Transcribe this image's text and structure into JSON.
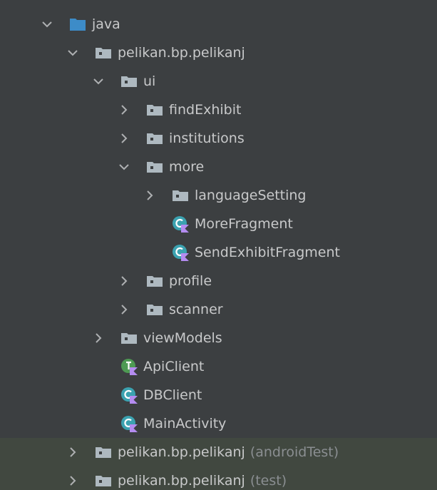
{
  "colors": {
    "background": "#3c3f41",
    "highlight_row": "#414840",
    "text": "#c8c9ca",
    "suffix_text": "#8a8e91",
    "arrow": "#aeb0b2",
    "folder_gray": "#aeb9c0",
    "folder_blue": "#3d8cc8",
    "class_teal": "#3ba2b0",
    "class_green": "#4e9a53",
    "kotlin_purple": "#b48cf0"
  },
  "tree": {
    "items": [
      {
        "label": "java",
        "level": 0,
        "arrow": "expanded",
        "icon": "folder-blue-icon",
        "highlight": false
      },
      {
        "label": "pelikan.bp.pelikanj",
        "level": 1,
        "arrow": "expanded",
        "icon": "package-folder-icon",
        "highlight": false
      },
      {
        "label": "ui",
        "level": 2,
        "arrow": "expanded",
        "icon": "package-folder-icon",
        "highlight": false
      },
      {
        "label": "findExhibit",
        "level": 3,
        "arrow": "collapsed",
        "icon": "package-folder-icon",
        "highlight": false
      },
      {
        "label": "institutions",
        "level": 3,
        "arrow": "collapsed",
        "icon": "package-folder-icon",
        "highlight": false
      },
      {
        "label": "more",
        "level": 3,
        "arrow": "expanded",
        "icon": "package-folder-icon",
        "highlight": false
      },
      {
        "label": "languageSetting",
        "level": 4,
        "arrow": "collapsed",
        "icon": "package-folder-icon",
        "highlight": false
      },
      {
        "label": "MoreFragment",
        "level": 4,
        "arrow": "none",
        "icon": "kotlin-class-icon",
        "highlight": false
      },
      {
        "label": "SendExhibitFragment",
        "level": 4,
        "arrow": "none",
        "icon": "kotlin-class-icon",
        "highlight": false
      },
      {
        "label": "profile",
        "level": 3,
        "arrow": "collapsed",
        "icon": "package-folder-icon",
        "highlight": false
      },
      {
        "label": "scanner",
        "level": 3,
        "arrow": "collapsed",
        "icon": "package-folder-icon",
        "highlight": false
      },
      {
        "label": "viewModels",
        "level": 2,
        "arrow": "collapsed",
        "icon": "package-folder-icon",
        "highlight": false
      },
      {
        "label": "ApiClient",
        "level": 2,
        "arrow": "none",
        "icon": "kotlin-interface-icon",
        "highlight": false
      },
      {
        "label": "DBClient",
        "level": 2,
        "arrow": "none",
        "icon": "kotlin-class-icon",
        "highlight": false
      },
      {
        "label": "MainActivity",
        "level": 2,
        "arrow": "none",
        "icon": "kotlin-class-icon",
        "highlight": false
      },
      {
        "label": "pelikan.bp.pelikanj",
        "suffix": "(androidTest)",
        "level": 1,
        "arrow": "collapsed",
        "icon": "package-folder-icon",
        "highlight": true
      },
      {
        "label": "pelikan.bp.pelikanj",
        "suffix": "(test)",
        "level": 1,
        "arrow": "collapsed",
        "icon": "package-folder-icon",
        "highlight": true
      }
    ]
  }
}
